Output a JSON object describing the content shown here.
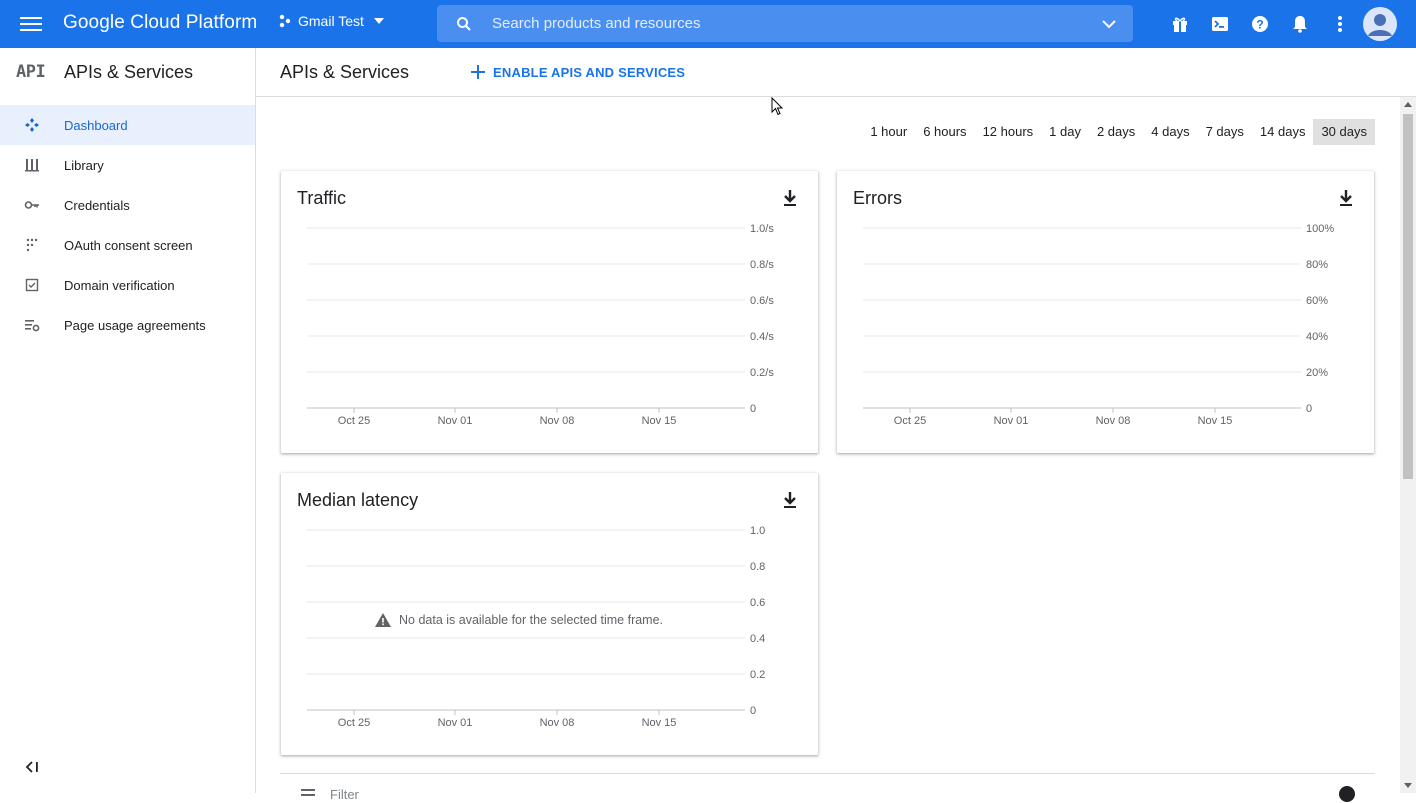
{
  "topbar": {
    "brand": "Google Cloud Platform",
    "project": "Gmail Test",
    "search_placeholder": "Search products and resources"
  },
  "sidebar": {
    "logo": "API",
    "title": "APIs & Services",
    "items": [
      {
        "label": "Dashboard",
        "icon": "dashboard-icon",
        "active": true
      },
      {
        "label": "Library",
        "icon": "library-icon"
      },
      {
        "label": "Credentials",
        "icon": "key-icon"
      },
      {
        "label": "OAuth consent screen",
        "icon": "oauth-icon"
      },
      {
        "label": "Domain verification",
        "icon": "checkbox-icon"
      },
      {
        "label": "Page usage agreements",
        "icon": "settings-list-icon"
      }
    ]
  },
  "main": {
    "title": "APIs & Services",
    "enable_label": "ENABLE APIS AND SERVICES",
    "ranges": [
      "1 hour",
      "6 hours",
      "12 hours",
      "1 day",
      "2 days",
      "4 days",
      "7 days",
      "14 days",
      "30 days"
    ],
    "selected_range": "30 days",
    "filter_label": "Filter"
  },
  "cards": [
    {
      "title": "Traffic",
      "y_ticks": [
        "1.0/s",
        "0.8/s",
        "0.6/s",
        "0.4/s",
        "0.2/s",
        "0"
      ],
      "x_ticks": [
        "Oct 25",
        "Nov 01",
        "Nov 08",
        "Nov 15"
      ],
      "message": ""
    },
    {
      "title": "Errors",
      "y_ticks": [
        "100%",
        "80%",
        "60%",
        "40%",
        "20%",
        "0"
      ],
      "x_ticks": [
        "Oct 25",
        "Nov 01",
        "Nov 08",
        "Nov 15"
      ],
      "message": ""
    },
    {
      "title": "Median latency",
      "y_ticks": [
        "1.0",
        "0.8",
        "0.6",
        "0.4",
        "0.2",
        "0"
      ],
      "x_ticks": [
        "Oct 25",
        "Nov 01",
        "Nov 08",
        "Nov 15"
      ],
      "message": "No data is available for the selected time frame."
    }
  ],
  "colors": {
    "accent": "#1a73e8",
    "active_bg": "#e8f0fe",
    "active_text": "#1967d2"
  }
}
